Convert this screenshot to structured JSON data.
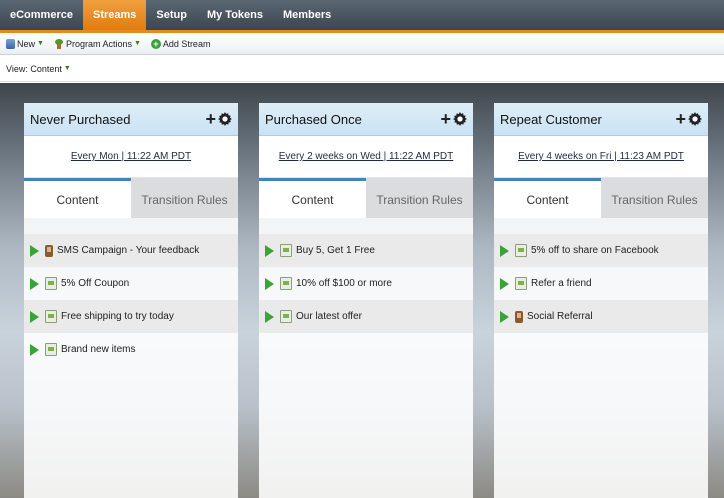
{
  "nav": {
    "tabs": [
      {
        "label": "eCommerce",
        "active": false
      },
      {
        "label": "Streams",
        "active": true
      },
      {
        "label": "Setup",
        "active": false
      },
      {
        "label": "My Tokens",
        "active": false
      },
      {
        "label": "Members",
        "active": false
      }
    ],
    "accent_color": "#e68a1a"
  },
  "toolbar": {
    "new_label": "New",
    "program_actions_label": "Program Actions",
    "add_stream_label": "Add Stream"
  },
  "view": {
    "label": "View: Content"
  },
  "columns": [
    {
      "title": "Never Purchased",
      "schedule": "Every Mon | 11:22 AM PDT",
      "tabs": {
        "content": "Content",
        "transition": "Transition Rules"
      },
      "items": [
        {
          "label": "SMS Campaign - Your feedback",
          "icon": "phone-icon"
        },
        {
          "label": "5% Off Coupon",
          "icon": "email-icon"
        },
        {
          "label": "Free shipping to try today",
          "icon": "email-icon"
        },
        {
          "label": "Brand new items",
          "icon": "email-icon"
        }
      ]
    },
    {
      "title": "Purchased Once",
      "schedule": "Every 2 weeks on Wed | 11:22 AM PDT",
      "tabs": {
        "content": "Content",
        "transition": "Transition Rules"
      },
      "items": [
        {
          "label": "Buy 5, Get 1 Free",
          "icon": "email-icon"
        },
        {
          "label": "10% off $100 or more",
          "icon": "email-icon"
        },
        {
          "label": "Our latest offer",
          "icon": "email-icon"
        }
      ]
    },
    {
      "title": "Repeat Customer",
      "schedule": "Every 4 weeks on Fri | 11:23 AM PDT",
      "tabs": {
        "content": "Content",
        "transition": "Transition Rules"
      },
      "items": [
        {
          "label": "5% off to share on Facebook",
          "icon": "email-icon"
        },
        {
          "label": "Refer a friend",
          "icon": "email-icon"
        },
        {
          "label": "Social Referral",
          "icon": "phone-icon"
        }
      ]
    }
  ]
}
